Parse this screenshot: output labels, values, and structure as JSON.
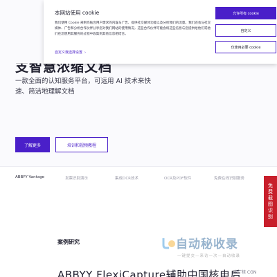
{
  "hero": {
    "headline": "支智慧浓缩文档",
    "subtitle": "一款全面的认知服务平台，可运用 AI 技术来快速、简洁地理解文档",
    "primary_button": "了解更多",
    "secondary_button": "培训和视频教程"
  },
  "tabs": [
    {
      "label": "ABBYY Vantage"
    },
    {
      "label": "发票识别演示"
    },
    {
      "label": "集成OCR技术"
    },
    {
      "label": "OCR及PDF软件"
    },
    {
      "label": "免费在线识别服务"
    }
  ],
  "case_study": {
    "label": "案例研究",
    "title": "ABBYY FlexiCapture辅助中国核电后",
    "partner_logo_text": "中广核 CGN"
  },
  "side_strip": {
    "text": "免费截图识别"
  },
  "watermark": {
    "main": "自动秘收录",
    "sub": "一键提交—来访一次—自动收录"
  },
  "cookie_banner": {
    "title": "本网站使用 cookie",
    "body": "我们使用 Cookie 来制作贴合用户需求的内容与广告、提供社交媒体功能以及分析我们的流量。我们还会与社交媒体、广告和分析合作伙伴分享您对我们网站的使用情况，这些合作伙伴可能会将这些信息与您提供给他们或他们在您使用其服务的过程中收集到其他信息相结合。",
    "settings_link": "自定义我选择设置",
    "settings_chevron": "›",
    "allow_all_button": "允许所有 cookie",
    "customize_button": "自定义",
    "necessary_only_button": "仅使用必要 cookie",
    "accent_color": "#4a1fc9"
  }
}
